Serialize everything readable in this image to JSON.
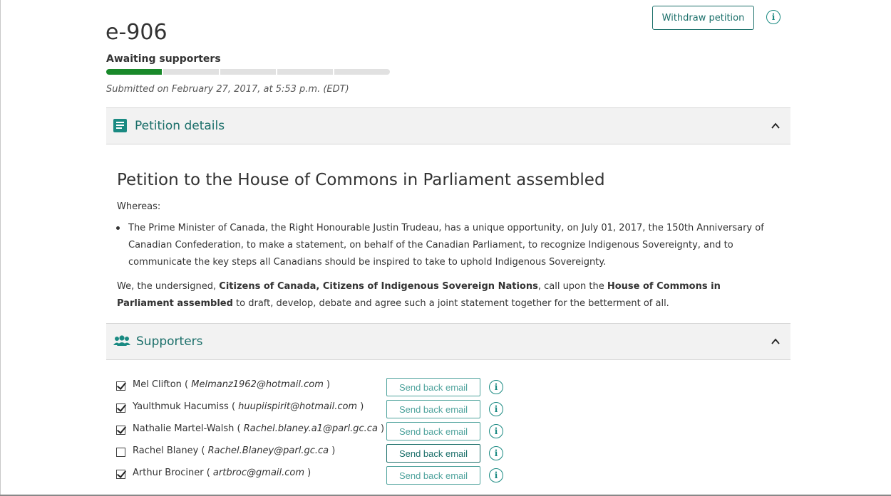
{
  "petition": {
    "id": "e-906",
    "status": "Awaiting supporters",
    "progress_segments": [
      1,
      0,
      0,
      0,
      0
    ],
    "submitted": "Submitted on February 27, 2017, at 5:53 p.m. (EDT)"
  },
  "header": {
    "withdraw_label": "Withdraw petition",
    "info_glyph": "i"
  },
  "details_panel": {
    "title": "Petition details",
    "icon": "document-icon"
  },
  "petition_body": {
    "title": "Petition to the House of Commons in Parliament assembled",
    "whereas": "Whereas:",
    "bullet": "The Prime Minister of Canada, the Right Honourable Justin Trudeau, has a unique opportunity, on July 01, 2017, the 150th Anniversary of Canadian Confederation, to make a statement, on behalf of the Canadian Parliament, to recognize Indigenous Sovereignty, and to communicate the key steps all Canadians should be inspired to take to uphold Indigenous Sovereignty.",
    "prayer_1": "We, the undersigned, ",
    "prayer_bold_1": "Citizens of Canada, Citizens of Indigenous Sovereign Nations",
    "prayer_2": ", call upon the ",
    "prayer_bold_2": "House of Commons in Parliament assembled",
    "prayer_3": " to draft, develop, debate and agree such a joint statement together for the betterment of all."
  },
  "supporters_panel": {
    "title": "Supporters",
    "icon": "group-icon",
    "send_label": "Send back email",
    "rows": [
      {
        "name": "Mel Clifton",
        "email": "Melmanz1962@hotmail.com",
        "checked": true
      },
      {
        "name": "Yaulthmuk Hacumiss",
        "email": "huupiispirit@hotmail.com",
        "checked": true
      },
      {
        "name": "Nathalie Martel-Walsh",
        "email": "Rachel.blaney.a1@parl.gc.ca",
        "checked": true
      },
      {
        "name": "Rachel Blaney",
        "email": "Rachel.Blaney@parl.gc.ca",
        "checked": false
      },
      {
        "name": "Arthur Brociner",
        "email": "artbroc@gmail.com",
        "checked": true
      }
    ]
  },
  "colors": {
    "accent": "#1b6f6a",
    "progress_done": "#19892a",
    "panel_bg": "#f2f2f2"
  }
}
